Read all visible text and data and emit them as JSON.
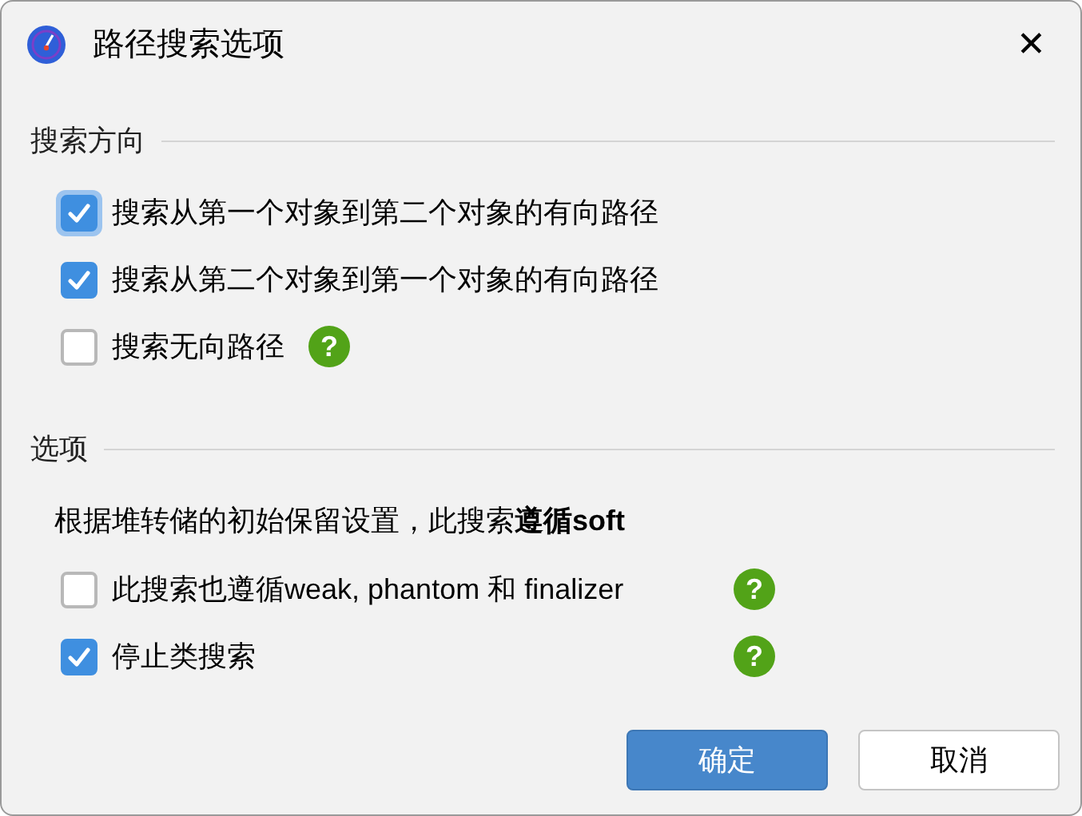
{
  "window": {
    "title": "路径搜索选项",
    "close": "✕"
  },
  "direction": {
    "heading": "搜索方向",
    "options": [
      {
        "label": "搜索从第一个对象到第二个对象的有向路径",
        "checked": true,
        "focused": true
      },
      {
        "label": "搜索从第二个对象到第一个对象的有向路径",
        "checked": true,
        "focused": false
      },
      {
        "label": "搜索无向路径",
        "checked": false,
        "focused": false,
        "help": "?"
      }
    ]
  },
  "options": {
    "heading": "选项",
    "description": "根据堆转储的初始保留设置，此搜索**遵循soft**",
    "items": [
      {
        "label": "此搜索也遵循weak, phantom 和 finalizer",
        "checked": false,
        "help": "?"
      },
      {
        "label": "停止类搜索",
        "checked": true,
        "help": "?"
      }
    ]
  },
  "buttons": [
    {
      "label": "确定",
      "primary": true
    },
    {
      "label": "取消",
      "primary": false
    }
  ]
}
